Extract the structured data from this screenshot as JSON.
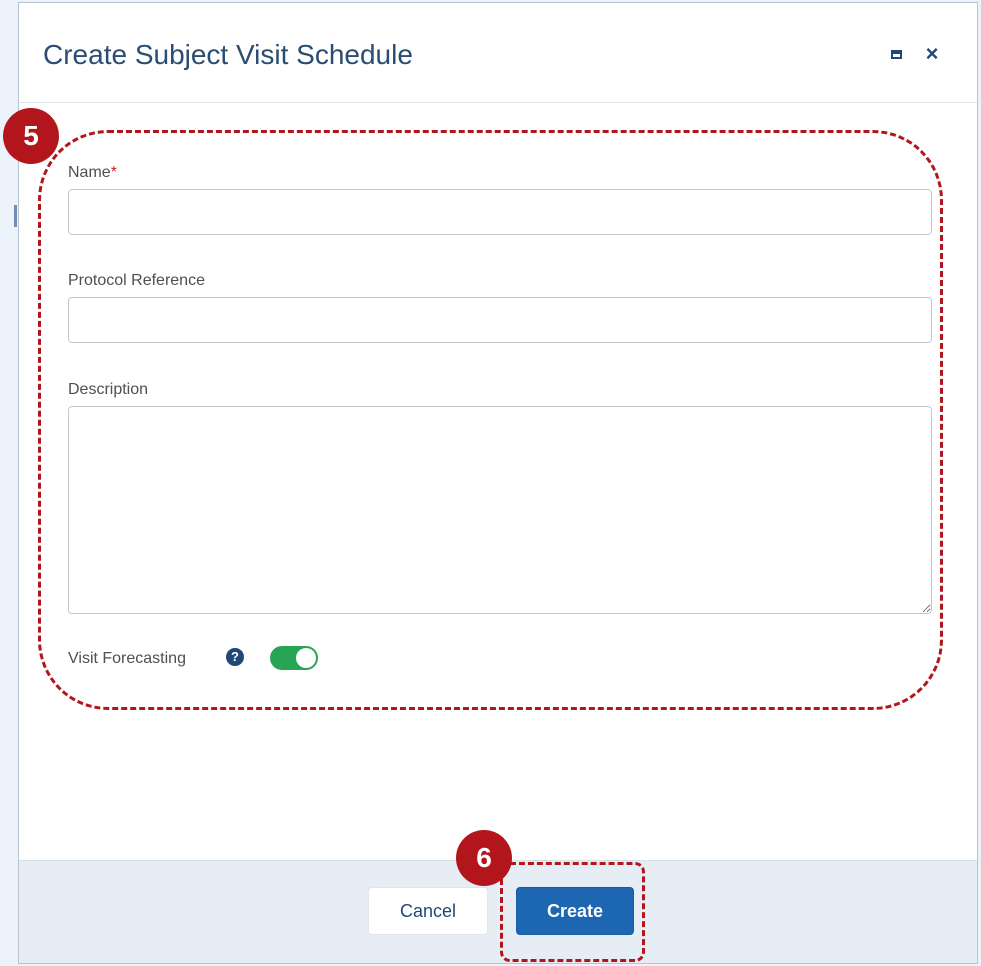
{
  "dialog": {
    "title": "Create Subject Visit Schedule",
    "maximize_icon": "window-maximize-icon",
    "close_icon": "close-icon",
    "close_glyph": "×"
  },
  "form": {
    "name_label": "Name",
    "name_required_marker": "*",
    "name_value": "",
    "protocol_label": "Protocol Reference",
    "protocol_value": "",
    "description_label": "Description",
    "description_value": "",
    "forecasting_label": "Visit Forecasting",
    "forecasting_help_glyph": "?",
    "forecasting_enabled": true
  },
  "footer": {
    "cancel_label": "Cancel",
    "create_label": "Create"
  },
  "annotations": {
    "step_form": "5",
    "step_create": "6"
  },
  "colors": {
    "title": "#2a4d71",
    "primary": "#1d66b2",
    "toggle_on": "#27a554",
    "annotation": "#b3151c",
    "required": "#c9242b"
  }
}
